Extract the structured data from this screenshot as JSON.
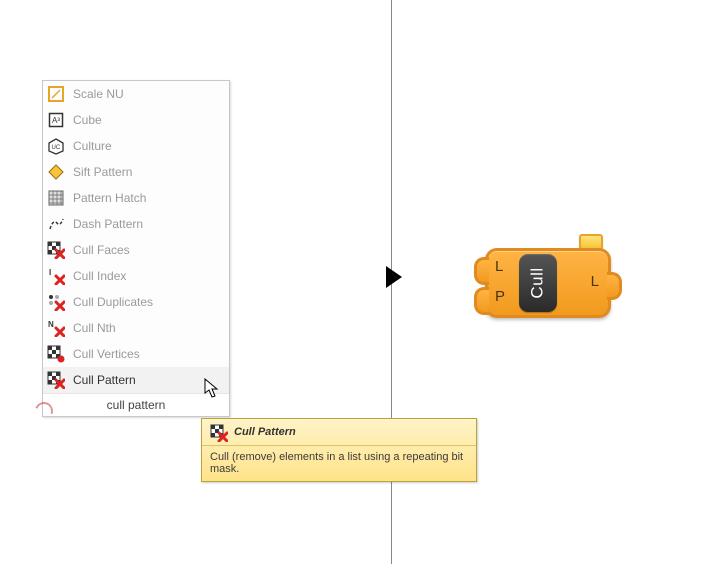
{
  "menu": {
    "items": [
      {
        "label": "Scale NU",
        "icon": "scale-nu-icon"
      },
      {
        "label": "Cube",
        "icon": "cube-icon"
      },
      {
        "label": "Culture",
        "icon": "culture-icon"
      },
      {
        "label": "Sift Pattern",
        "icon": "sift-pattern-icon"
      },
      {
        "label": "Pattern Hatch",
        "icon": "pattern-hatch-icon"
      },
      {
        "label": "Dash Pattern",
        "icon": "dash-pattern-icon"
      },
      {
        "label": "Cull Faces",
        "icon": "cull-faces-icon"
      },
      {
        "label": "Cull Index",
        "icon": "cull-index-icon"
      },
      {
        "label": "Cull Duplicates",
        "icon": "cull-duplicates-icon"
      },
      {
        "label": "Cull Nth",
        "icon": "cull-nth-icon"
      },
      {
        "label": "Cull Vertices",
        "icon": "cull-vertices-icon"
      },
      {
        "label": "Cull Pattern",
        "icon": "cull-pattern-icon"
      }
    ],
    "selected_index": 11,
    "search_value": "cull pattern"
  },
  "tooltip": {
    "title": "Cull Pattern",
    "body": "Cull (remove) elements in a list using a repeating bit mask."
  },
  "node": {
    "name": "Cull",
    "inputs": [
      "L",
      "P"
    ],
    "outputs": [
      "L"
    ]
  }
}
